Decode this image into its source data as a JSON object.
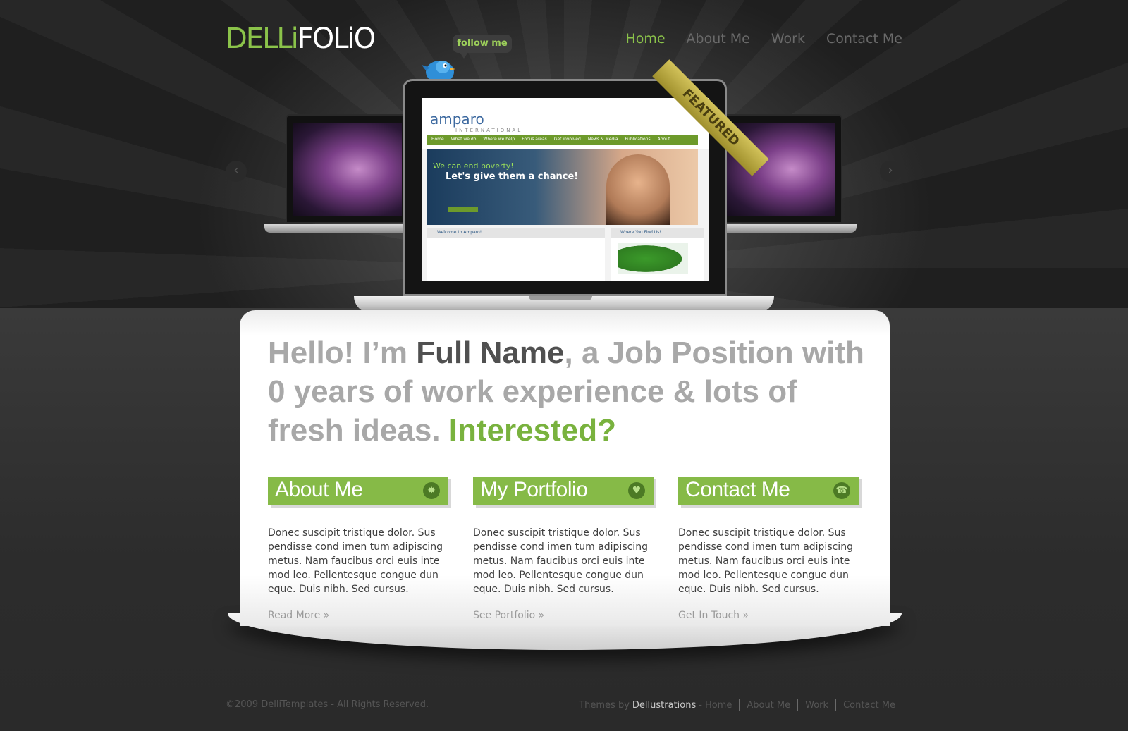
{
  "header": {
    "logo_part1": "DELLi",
    "logo_part2": "FOLiO",
    "follow_label": "follow me",
    "nav": [
      "Home",
      "About Me",
      "Work",
      "Contact Me"
    ]
  },
  "showcase": {
    "featured_label": "FEATURED",
    "site_logo": "amparo",
    "site_sub": "INTERNATIONAL",
    "site_nav": [
      "Home",
      "What we do",
      "Where we help",
      "Focus areas",
      "Get involved",
      "News & Media",
      "Publications",
      "About"
    ],
    "hero_line1": "We can end poverty!",
    "hero_line2": "Let's give them a chance!",
    "welcome_label": "Welcome to Amparo!",
    "where_label": "Where You Find Us!"
  },
  "intro": {
    "part1": "Hello! I’m ",
    "name": "Full Name",
    "part2": ", a Job Position with 0 years of work experience & lots of fresh ideas. ",
    "cta": "Interested?"
  },
  "columns": [
    {
      "title": "About Me",
      "icon": "ribbon-icon",
      "text": "Donec suscipit tristique dolor. Sus pendisse cond imen tum adipiscing metus. Nam faucibus orci euis inte mod leo. Pellentesque congue dun eque. Duis nibh. Sed cursus.",
      "link": "Read More »"
    },
    {
      "title": "My Portfolio",
      "icon": "heart-icon",
      "text": "Donec suscipit tristique dolor. Sus pendisse cond imen tum adipiscing metus. Nam faucibus orci euis inte mod leo. Pellentesque congue dun eque. Duis nibh. Sed cursus.",
      "link": "See Portfolio »"
    },
    {
      "title": "Contact Me",
      "icon": "phone-icon",
      "text": "Donec suscipit tristique dolor. Sus pendisse cond imen tum adipiscing metus. Nam faucibus orci euis inte mod leo. Pellentesque congue dun eque. Duis nibh. Sed cursus.",
      "link": "Get In Touch »"
    }
  ],
  "footer": {
    "copyright": "©2009 DelliTemplates - All Rights Reserved.",
    "themes_by": "Themes by",
    "brand": "Dellustrations",
    "links": [
      "Home",
      "About Me",
      "Work",
      "Contact Me"
    ]
  },
  "colors": {
    "accent": "#86ba47",
    "dark_bg": "#2f2f2f"
  }
}
